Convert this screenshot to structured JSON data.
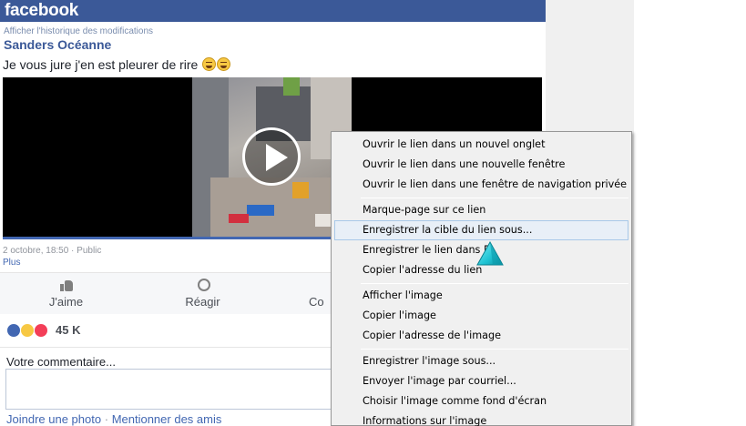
{
  "header": {
    "logo": "facebook"
  },
  "post": {
    "history_link": "Afficher l'historique des modifications",
    "author": "Sanders Océanne",
    "text": "Je vous jure j'en est pleurer de rire",
    "date": "2 octobre, 18:50 · Public",
    "more": "Plus"
  },
  "actions": {
    "like": "J'aime",
    "react": "Réagir",
    "comment": "Co"
  },
  "reactions": {
    "count": "45 K"
  },
  "comment": {
    "label": "Votre commentaire...",
    "links": [
      "Joindre une photo",
      "Mentionner des amis"
    ],
    "separator": "·"
  },
  "context_menu": {
    "items": [
      {
        "label": "Ouvrir le lien dans un nouvel onglet",
        "state": "normal"
      },
      {
        "label": "Ouvrir le lien dans une nouvelle fenêtre",
        "state": "normal"
      },
      {
        "label": "Ouvrir le lien dans une fenêtre de navigation privée",
        "state": "normal"
      },
      {
        "label": "Marque-page sur ce lien",
        "state": "normal"
      },
      {
        "label": "Enregistrer la cible du lien sous...",
        "state": "hover"
      },
      {
        "label": "Enregistrer le lien dans P",
        "state": "normal"
      },
      {
        "label": "Copier l'adresse du lien",
        "state": "normal"
      },
      {
        "label": "Afficher l'image",
        "state": "normal"
      },
      {
        "label": "Copier l'image",
        "state": "normal"
      },
      {
        "label": "Copier l'adresse de l'image",
        "state": "normal"
      },
      {
        "label": "Enregistrer l'image sous...",
        "state": "normal"
      },
      {
        "label": "Envoyer l'image par courriel...",
        "state": "normal"
      },
      {
        "label": "Choisir l'image comme fond d'écran",
        "state": "normal"
      },
      {
        "label": "Informations sur l'image",
        "state": "normal"
      }
    ]
  },
  "colors": {
    "brand": "#3b5998",
    "link": "#4267b2",
    "menu_bg": "#f0f0f0",
    "menu_hover": "#e8eff7",
    "cursor": "#22c6d6"
  },
  "icons": [
    "play-icon",
    "like-icon",
    "react-icon",
    "haha-emoji-icon",
    "reaction-like-icon",
    "reaction-haha-icon",
    "reaction-love-icon",
    "triangle-cursor-icon"
  ]
}
